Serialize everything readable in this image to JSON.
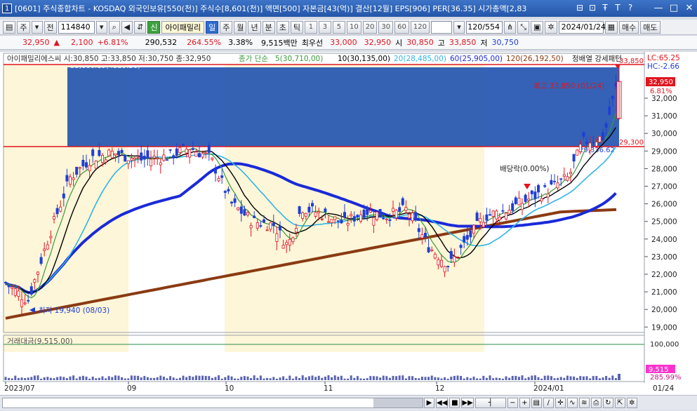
{
  "window": {
    "index": "1",
    "title": "[0601] 주식종합차트 - KOSDAQ 외국인보유[550(천)] 주식수[8,601(천)] 액면[500] 자본금[43(억)] 결산[12월] EPS[906] PER[36.35] 시가총액[2,83"
  },
  "toolbar": {
    "market": "주",
    "prev": "전",
    "code": "114840",
    "credit_badge": "신",
    "stock_name": "아이패밀리",
    "periods": [
      "일",
      "주",
      "월",
      "년",
      "분",
      "초",
      "틱"
    ],
    "intervals": [
      "1",
      "3",
      "5",
      "10",
      "20",
      "30",
      "60",
      "120"
    ],
    "count": "120/554",
    "date": "2024/01/24",
    "buy": "매수",
    "sell": "매도"
  },
  "quote": {
    "price": "32,950",
    "change": "2,100",
    "change_pct": "+6.81%",
    "volume": "290,532",
    "volume_ratio": "264.55%",
    "turnover": "3.38%",
    "amount": "9,515백만",
    "best_ask_label": "최우선",
    "best_ask": "33,000",
    "best_bid": "32,950",
    "open_label": "시",
    "open": "30,850",
    "high_label": "고",
    "high": "33,850",
    "low_label": "저",
    "low": "30,750"
  },
  "legend": {
    "name_ohlc": "아이패밀리에스씨 시:30,850 고:33,850 저:30,750 종:32,950",
    "ma_title": "종가 단순",
    "ma5": "5(30,710,00)",
    "ma10": "10(30,135,00)",
    "ma20": "20(28,485,00)",
    "ma60": "60(25,905,00)",
    "ma120": "120(26,192,50)",
    "pattern": "정배열 강세패턴",
    "lc": "LC:65.25",
    "hc": "HC:-2.66"
  },
  "annotations": {
    "box_top": "33,666.19(4329.56)",
    "box_bottom": "29,336.62",
    "high_mark": "최고 33,850 (01/24)",
    "low_mark": "최저 19,940 (08/03)",
    "dividend": "배당락(0.00%)",
    "res_line": "29,300",
    "top_line": "33,850"
  },
  "price_axis": {
    "current": "32,950",
    "current_pct": "6.81%",
    "ticks": [
      "32,000",
      "31,000",
      "30,000",
      "29,000",
      "28,000",
      "27,000",
      "26,000",
      "25,000",
      "24,000",
      "23,000",
      "22,000",
      "21,000",
      "20,000",
      "19,000"
    ]
  },
  "volume_pane": {
    "label": "거래대금(9,515.00)",
    "tick": "100,000",
    "current": "9,515",
    "current_pct": "285.99%"
  },
  "time_axis": {
    "labels": [
      "2023/07",
      "09",
      "10",
      "11",
      "12",
      "2024/01"
    ],
    "last": "01/24"
  },
  "colors": {
    "up": "#e0141e",
    "down": "#1f3fd6",
    "box": "#2455b0",
    "ma5": "#3a9a3a",
    "ma10": "#000000",
    "ma20": "#30b4e8",
    "ma60": "#1a2ad8",
    "ma120": "#8b3a12"
  }
}
